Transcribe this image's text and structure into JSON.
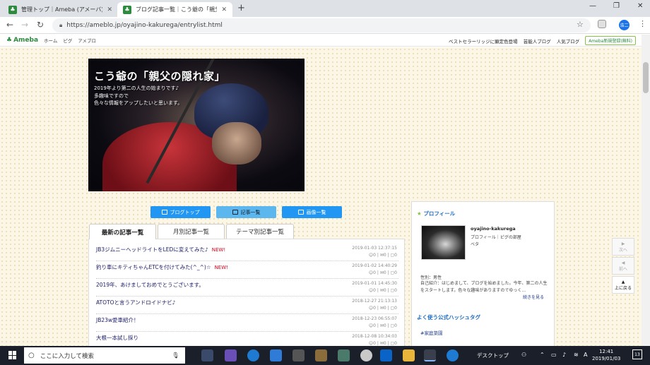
{
  "browser": {
    "tabs": [
      {
        "label": "管理トップ｜Ameba (アメーバ)",
        "active": false
      },
      {
        "label": "ブログ記事一覧｜こう爺の「親父の隠",
        "active": true
      }
    ],
    "url": "https://ameblo.jp/oyajino-kakurega/entrylist.html",
    "profile_initial": "浩二"
  },
  "ameba_header": {
    "logo": "Ameba",
    "crumbs": [
      "ホーム",
      "ピグ",
      "アメブロ"
    ],
    "right_links": [
      "ベストセラーリッジに顕定色登場",
      "芸能人ブログ",
      "人気ブログ"
    ],
    "signup": "Ameba新規登録(無料)"
  },
  "blog": {
    "title": "こう爺の「親父の隠れ家」",
    "description": [
      "2019年より第二の人生の始まりです♪",
      "多趣味ですので",
      "色々な情報をアップしたいと思います。"
    ]
  },
  "nav_buttons": [
    {
      "label": "ブログトップ",
      "selected": false
    },
    {
      "label": "記事一覧",
      "selected": true
    },
    {
      "label": "画像一覧",
      "selected": false
    }
  ],
  "entry_tabs": [
    "最新の記事一覧",
    "月別記事一覧",
    "テーマ別記事一覧"
  ],
  "entries": [
    {
      "title": "JB3ジムニーヘッドライトをLEDに変えてみた♪",
      "new": "NEW!",
      "date": "2019-01-03 12:37:15",
      "stats": "☺0 | ✉0 | ▢0"
    },
    {
      "title": "釣り車にキティちゃんETCを付けてみた(^_^)☆",
      "new": "NEW!",
      "date": "2019-01-02 14:40:29",
      "stats": "☺0 | ✉0 | ▢0"
    },
    {
      "title": "2019年、あけましておめでとうございます。",
      "new": "",
      "date": "2019-01-01 14:45:30",
      "stats": "☺0 | ✉0 | ▢0"
    },
    {
      "title": "ATOTOと言うアンドロイドナビ♪",
      "new": "",
      "date": "2018-12-27 21:13:13",
      "stats": "☺0 | ✉0 | ▢0"
    },
    {
      "title": "JB23w愛車紹介！",
      "new": "",
      "date": "2018-12-23 06:55:07",
      "stats": "☺0 | ✉0 | ▢0"
    },
    {
      "title": "大根一本試し採り",
      "new": "",
      "date": "2018-12-08 10:34:03",
      "stats": "☺0 | ✉0 | ▢0"
    }
  ],
  "sidebar": {
    "profile_heading": "プロフィール",
    "name": "oyajino-kakurega",
    "links": "プロフィール｜ピグの部屋",
    "nickname": "ベタ",
    "gender": "性別：男性",
    "bio": "自己紹介：はじめまして、ブログを始めました。今年、第二の人生をスタートします。色々な趣味がありますのでゆっく...",
    "more": "続きを見る",
    "hashtag_heading": "よく使う公式ハッシュタグ",
    "hashtag": "#家庭菜園"
  },
  "pager": {
    "prev": "次へ",
    "next": "前へ",
    "top": "上に戻る"
  },
  "taskbar": {
    "search_placeholder": "ここに入力して検索",
    "desktop_label": "デスクトップ",
    "time": "12:41",
    "date": "2019/01/03",
    "notif_count": "13",
    "ime": "A"
  }
}
